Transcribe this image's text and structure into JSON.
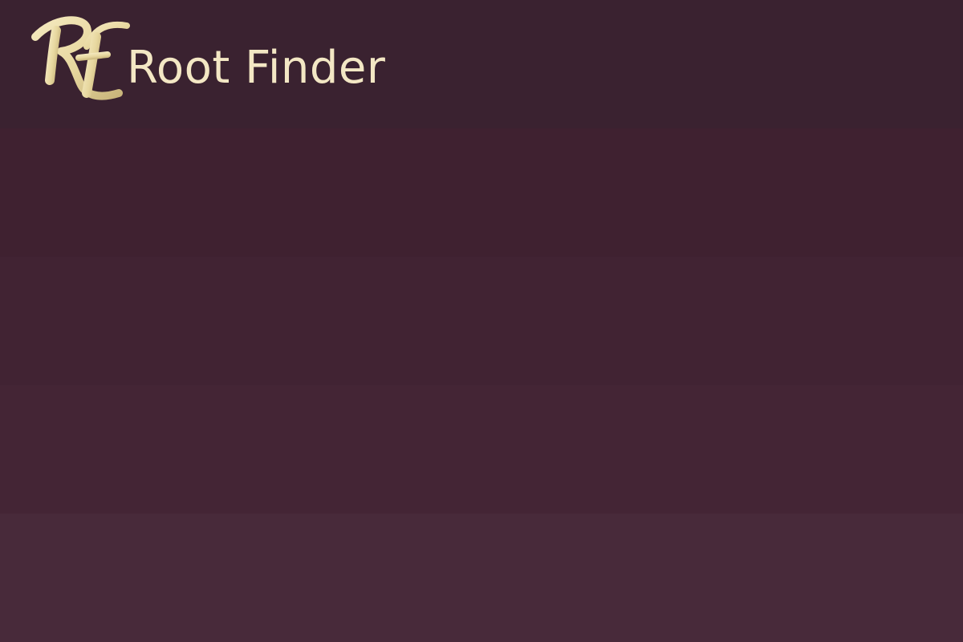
{
  "app": {
    "brand_name": "Root Finder",
    "logo_text": "RF"
  },
  "colors": {
    "brand_text": "#f3e7c4",
    "logo_gold": "#e9dcaa",
    "background_top": "#3a2230",
    "background_bottom": "#482a3a"
  }
}
